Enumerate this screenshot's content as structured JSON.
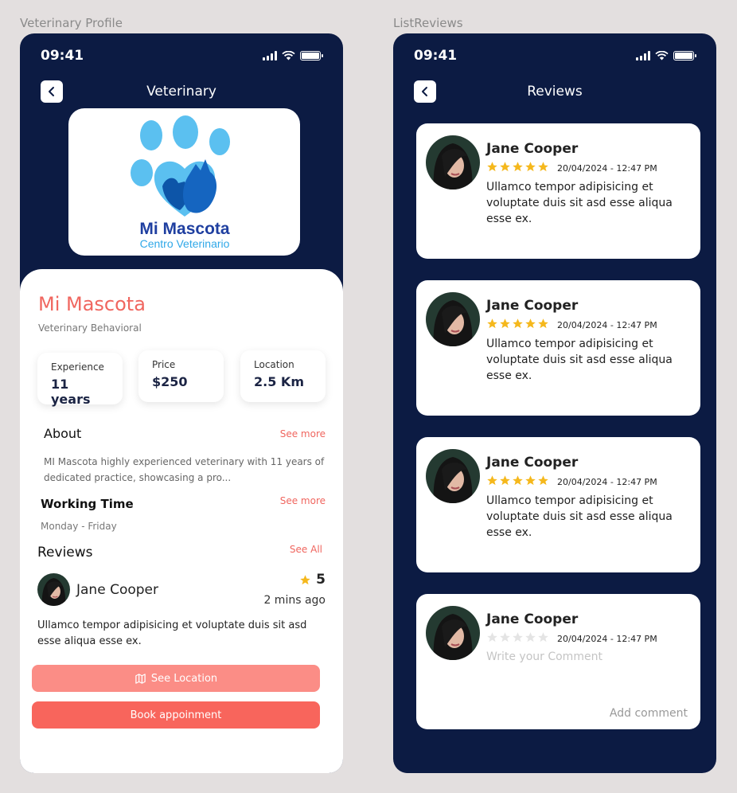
{
  "labels": {
    "left_frame": "Veterinary Profile",
    "right_frame": "ListReviews"
  },
  "status": {
    "time": "09:41"
  },
  "profile": {
    "nav_title": "Veterinary",
    "logo": {
      "line1": "Mi Mascota",
      "line2": "Centro Veterinario"
    },
    "name": "Mi Mascota",
    "specialty": "Veterinary Behavioral",
    "stats": [
      {
        "label": "Experience",
        "value": "11 years"
      },
      {
        "label": "Price",
        "value": "$250"
      },
      {
        "label": "Location",
        "value": "2.5 Km"
      }
    ],
    "about_title": "About",
    "about_link": "See more",
    "about_text": "MI Mascota highly experienced veterinary with 11 years of dedicated practice, showcasing a pro...",
    "working_title": "Working Time",
    "working_link": "See more",
    "working_days": "Monday - Friday",
    "reviews_title": "Reviews",
    "reviews_link": "See All",
    "review": {
      "name": "Jane Cooper",
      "rating": "5",
      "time": "2 mins ago",
      "text": "Ullamco tempor adipisicing et voluptate duis sit asd esse aliqua esse ex."
    },
    "location_button": "See Location",
    "book_button": "Book appoinment"
  },
  "reviews_page": {
    "nav_title": "Reviews",
    "cards": [
      {
        "name": "Jane Cooper",
        "stars": 5,
        "date": "20/04/2024 - 12:47 PM",
        "text": "Ullamco tempor adipisicing et voluptate duis sit asd esse aliqua esse ex."
      },
      {
        "name": "Jane Cooper",
        "stars": 5,
        "date": "20/04/2024 - 12:47 PM",
        "text": "Ullamco tempor adipisicing et voluptate duis sit asd esse aliqua esse ex."
      },
      {
        "name": "Jane Cooper",
        "stars": 5,
        "date": "20/04/2024 - 12:47 PM",
        "text": "Ullamco tempor adipisicing et voluptate duis sit asd esse aliqua esse ex."
      }
    ],
    "comment_card": {
      "name": "Jane Cooper",
      "stars": 0,
      "date": "20/04/2024 - 12:47 PM",
      "placeholder": "Write your Comment",
      "add_label": "Add comment"
    }
  },
  "colors": {
    "navy": "#0c1b43",
    "accent": "#f0665f",
    "star": "#f5b81c",
    "star_empty": "#e4e4e4",
    "location_button": "#fb8d86",
    "book_button": "#f8655c"
  },
  "icons": [
    "chevron-left-icon",
    "signal-icon",
    "wifi-icon",
    "battery-icon",
    "star-icon",
    "map-icon",
    "paw-logo-icon"
  ]
}
